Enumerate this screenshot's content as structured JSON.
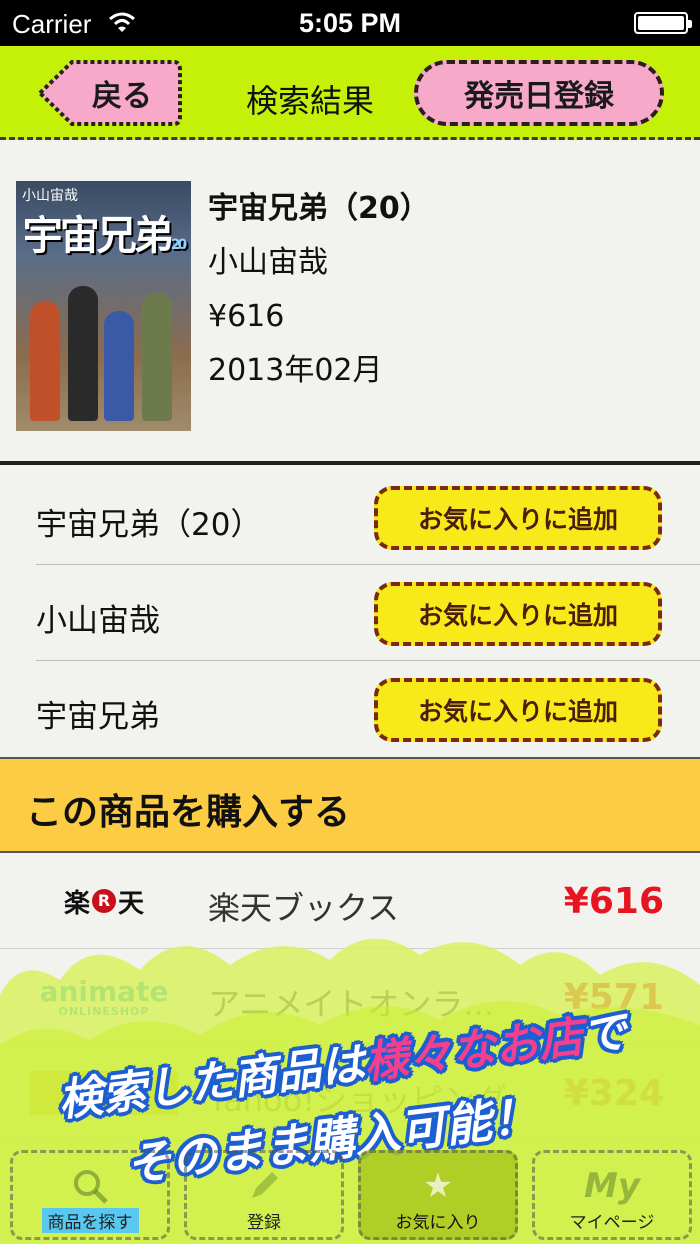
{
  "status_bar": {
    "carrier": "Carrier",
    "time": "5:05 PM"
  },
  "nav": {
    "back_label": "戻る",
    "title": "検索結果",
    "register_label": "発売日登録"
  },
  "product": {
    "title": "宇宙兄弟（20）",
    "author": "小山宙哉",
    "price": "¥616",
    "date": "2013年02月",
    "cover_text": "宇宙兄弟",
    "cover_author": "小山宙哉",
    "cover_volume": "20"
  },
  "favorites": {
    "button_label": "お気に入りに追加",
    "rows": [
      {
        "label": "宇宙兄弟（20）"
      },
      {
        "label": "小山宙哉"
      },
      {
        "label": "宇宙兄弟"
      }
    ]
  },
  "purchase": {
    "title": "この商品を購入する"
  },
  "stores": [
    {
      "logo": "楽天",
      "logo_mark": "R",
      "name": "楽天ブックス",
      "price": "¥616"
    },
    {
      "logo": "animate",
      "logo_sub": "ONLINESHOP",
      "name": "アニメイトオンラ...",
      "price": "¥571"
    },
    {
      "logo": "Yahoo!",
      "name": "Yahoo!ショッピング",
      "price": "¥324"
    }
  ],
  "promo": {
    "line1_a": "検索した商品は",
    "line1_b": "様々なお店",
    "line1_c": "で",
    "line2": "そのまま購入可能！"
  },
  "tabs": [
    {
      "label": "商品を探す",
      "icon": "search-icon"
    },
    {
      "label": "登録",
      "icon": "pencil-icon"
    },
    {
      "label": "お気に入り",
      "icon": "star-icon"
    },
    {
      "label": "マイページ",
      "icon": "my-icon",
      "icon_text": "My"
    }
  ],
  "colors": {
    "nav_green": "#c5f008",
    "button_pink": "#f6a9c8",
    "fav_yellow": "#f7e91a",
    "purchase_header": "#fccc44",
    "price_red": "#e8141f",
    "promo_blue": "#1d5fd0",
    "promo_pink": "#f43f8e"
  }
}
